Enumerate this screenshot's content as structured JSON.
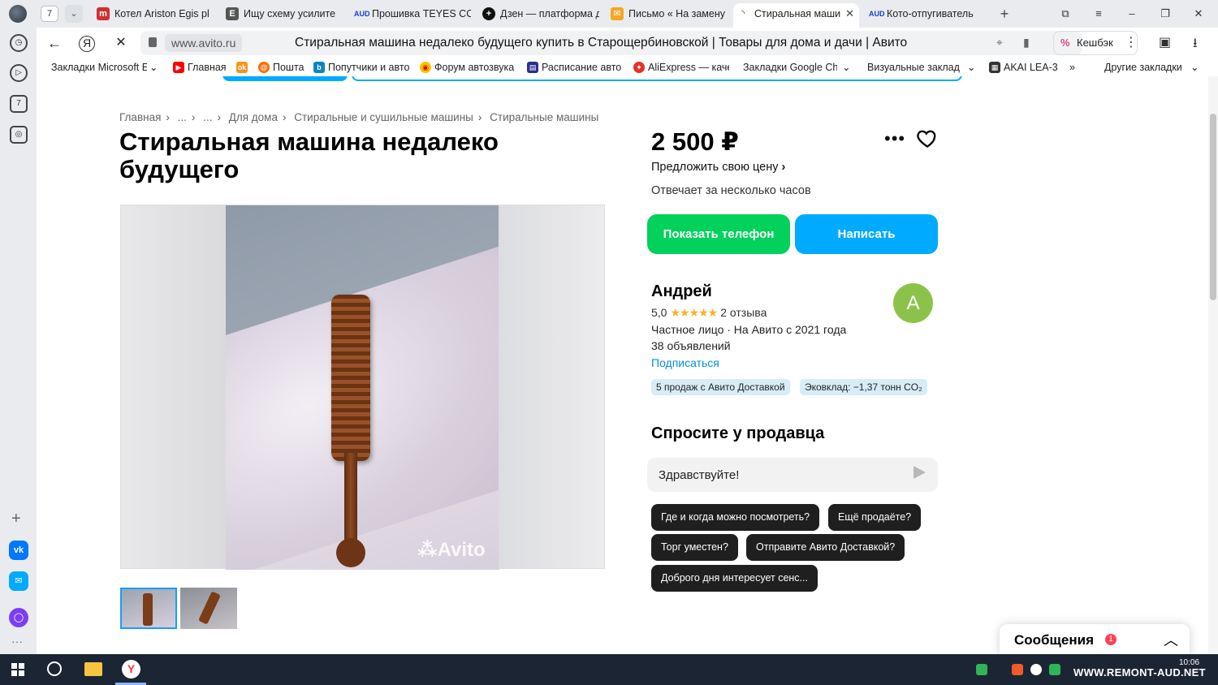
{
  "browser": {
    "tab_count": "7",
    "tabs": [
      {
        "label": "Котел Ariston Egis pl",
        "icon": "m",
        "color": "#d32f2f"
      },
      {
        "label": "Ищу схему усилите",
        "icon": "E",
        "color": "#444444"
      },
      {
        "label": "Прошивка TEYES CC",
        "icon": "AUD",
        "color": "#1a3fd1"
      },
      {
        "label": "Дзен — платформа д",
        "icon": "+",
        "color": "#111111"
      },
      {
        "label": "Письмо « На замену",
        "icon": "M",
        "color": "#f5a623"
      },
      {
        "label": "Стиральная маши",
        "icon": "avito",
        "color": "#333333"
      },
      {
        "label": "Кото-отпугиватель",
        "icon": "AUD",
        "color": "#1a3fd1"
      }
    ],
    "domain": "www.avito.ru",
    "page_title": "Стиральная машина недалеко будущего купить в Старощербиновской | Товары для дома и дачи | Авито",
    "cashback_label": "Кешбэк",
    "bookmarks": [
      {
        "label": "Закладки Microsoft E",
        "icon": ""
      },
      {
        "label": "Главная",
        "icon": "yt"
      },
      {
        "label": "",
        "icon": "ok"
      },
      {
        "label": "Пошта",
        "icon": "po"
      },
      {
        "label": "Попутчики и авто",
        "icon": "bb"
      },
      {
        "label": "Форум автозвука",
        "icon": "fa"
      },
      {
        "label": "Расписание авто",
        "icon": "ra"
      },
      {
        "label": "AliExpress — каче",
        "icon": "ae"
      },
      {
        "label": "Закладки Google Ch",
        "icon": ""
      },
      {
        "label": "Визуальные заклад",
        "icon": ""
      },
      {
        "label": "AKAI LEA-3",
        "icon": "ak"
      },
      {
        "label": "Другие закладки",
        "icon": ""
      }
    ]
  },
  "listing": {
    "breadcrumb": [
      "Главная",
      "...",
      "...",
      "Для дома",
      "Стиральные и сушильные машины",
      "Стиральные машины"
    ],
    "title": "Стиральная машина недалеко будущего",
    "photo_watermark": "Avito",
    "price": "2 500 ₽",
    "offer_price": "Предложить свою цену",
    "response_time": "Отвечает за несколько часов",
    "show_phone": "Показать телефон",
    "write": "Написать"
  },
  "seller": {
    "name": "Андрей",
    "rating": "5,0",
    "reviews": "2 отзыва",
    "type_since": "Частное лицо · На Авито с 2021 года",
    "ads_count": "38 объявлений",
    "subscribe": "Подписаться",
    "avatar_letter": "А",
    "avatar_color": "#8bc34a",
    "badges": [
      "5 продаж с Авито Доставкой",
      "Эковклад: −1,37 тонн CO₂"
    ]
  },
  "ask": {
    "title": "Спросите у продавца",
    "input_value": "Здравствуйте!",
    "quick_questions": [
      "Где и когда можно посмотреть?",
      "Ещё продаёте?",
      "Торг уместен?",
      "Отправите Авито Доставкой?",
      "Доброго дня интересует сенс..."
    ]
  },
  "messages": {
    "label": "Сообщения",
    "unread": "1"
  },
  "taskbar": {
    "time": "10:06",
    "watermark": "WWW.REMONT-AUD.NET"
  },
  "colors": {
    "avito_green": "#02d15c",
    "avito_blue": "#00aaff",
    "link": "#0090d9",
    "star": "#ffb021"
  }
}
